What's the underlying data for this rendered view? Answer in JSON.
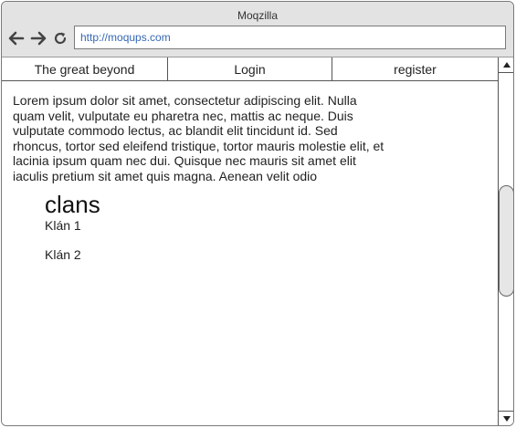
{
  "window": {
    "title": "Moqzilla"
  },
  "toolbar": {
    "url": "http://moqups.com"
  },
  "nav": {
    "items": [
      {
        "label": "The great beyond"
      },
      {
        "label": "Login"
      },
      {
        "label": "register"
      }
    ]
  },
  "content": {
    "lorem": "Lorem ipsum dolor sit amet, consectetur adipiscing elit. Nulla quam velit, vulputate eu pharetra nec, mattis ac neque. Duis vulputate commodo lectus, ac blandit elit tincidunt id. Sed rhoncus, tortor sed eleifend tristique, tortor mauris molestie elit, et lacinia ipsum quam nec dui. Quisque nec mauris sit amet elit iaculis pretium sit amet quis magna. Aenean velit odio",
    "clans_heading": "clans",
    "clans": [
      {
        "label": "Klán 1"
      },
      {
        "label": "Klán 2"
      }
    ]
  },
  "icons": {
    "back": "arrow-left-icon",
    "forward": "arrow-right-icon",
    "reload": "reload-icon",
    "scroll_up": "triangle-up-icon",
    "scroll_down": "triangle-down-icon"
  },
  "colors": {
    "chrome_bg": "#e3e3e3",
    "url_text": "#3568b4",
    "border": "#7a7a7a",
    "scroll_thumb": "#e6e6e6"
  }
}
